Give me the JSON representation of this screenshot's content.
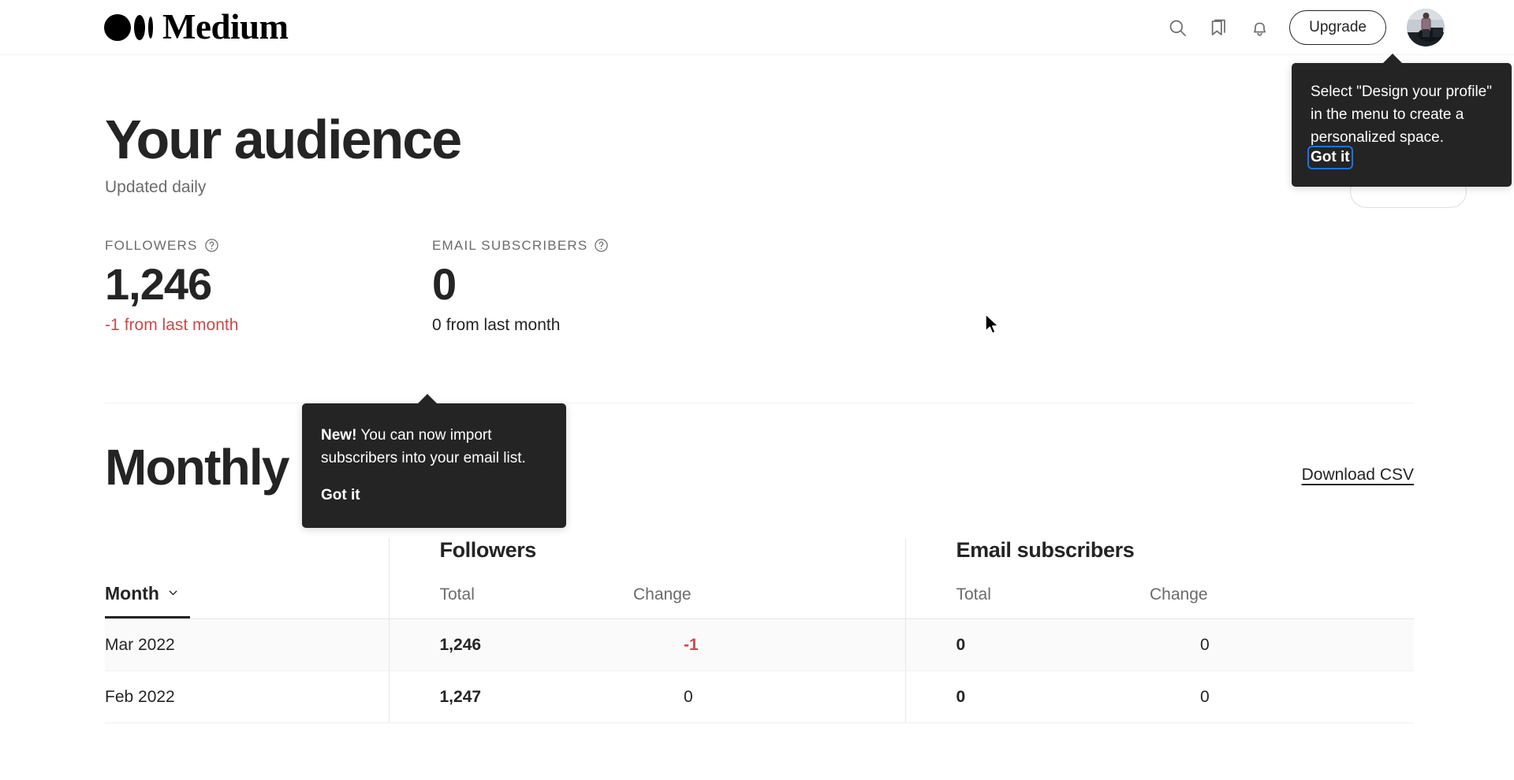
{
  "header": {
    "brand": "Medium",
    "icons": [
      {
        "name": "search-icon",
        "label": "Search"
      },
      {
        "name": "bookmark-icon",
        "label": "Bookmarks"
      },
      {
        "name": "bell-icon",
        "label": "Notifications"
      }
    ],
    "upgrade_label": "Upgrade",
    "avatar_alt": "User profile"
  },
  "page": {
    "title": "Your audience",
    "subtitle": "Updated daily"
  },
  "stats": [
    {
      "label": "FOLLOWERS",
      "help_icon": "question-circle-icon",
      "value": "1,246",
      "change": "-1",
      "change_suffix": "from last month",
      "negative": true
    },
    {
      "label": "EMAIL SUBSCRIBERS",
      "help_icon": "question-circle-icon",
      "value": "0",
      "change": "0",
      "change_suffix": "from last month",
      "negative": false
    }
  ],
  "growth": {
    "title": "Monthly growth",
    "csv_label": "Download CSV"
  },
  "table": {
    "month_header": "Month",
    "month_sort_icon": "chevron-down-icon",
    "groups": [
      {
        "label": "Followers"
      },
      {
        "label": "Email subscribers"
      }
    ],
    "sub_headers": {
      "followers_total": "Total",
      "followers_change": "Change",
      "email_total": "Total",
      "email_change": "Change"
    },
    "rows": [
      {
        "month": "Mar 2022",
        "followers_total": "1,246",
        "followers_change": "-1",
        "followers_change_negative": true,
        "email_total": "0",
        "email_change": "0"
      },
      {
        "month": "Feb 2022",
        "followers_total": "1,247",
        "followers_change": "0",
        "followers_change_negative": false,
        "email_total": "0",
        "email_change": "0"
      }
    ]
  },
  "tooltips": {
    "profile": {
      "text": "Select \"Design your profile\" in the menu to create a personalized space.",
      "cta": "Got it"
    },
    "subscribers": {
      "lead": "New!",
      "text": " You can now import subscribers into your email list.",
      "cta": "Got it"
    }
  },
  "colors": {
    "text": "#242424",
    "muted": "#6b6b6b",
    "negative": "#c94a4a",
    "tooltip_bg": "#242424",
    "focus_ring": "#1a73e8"
  }
}
